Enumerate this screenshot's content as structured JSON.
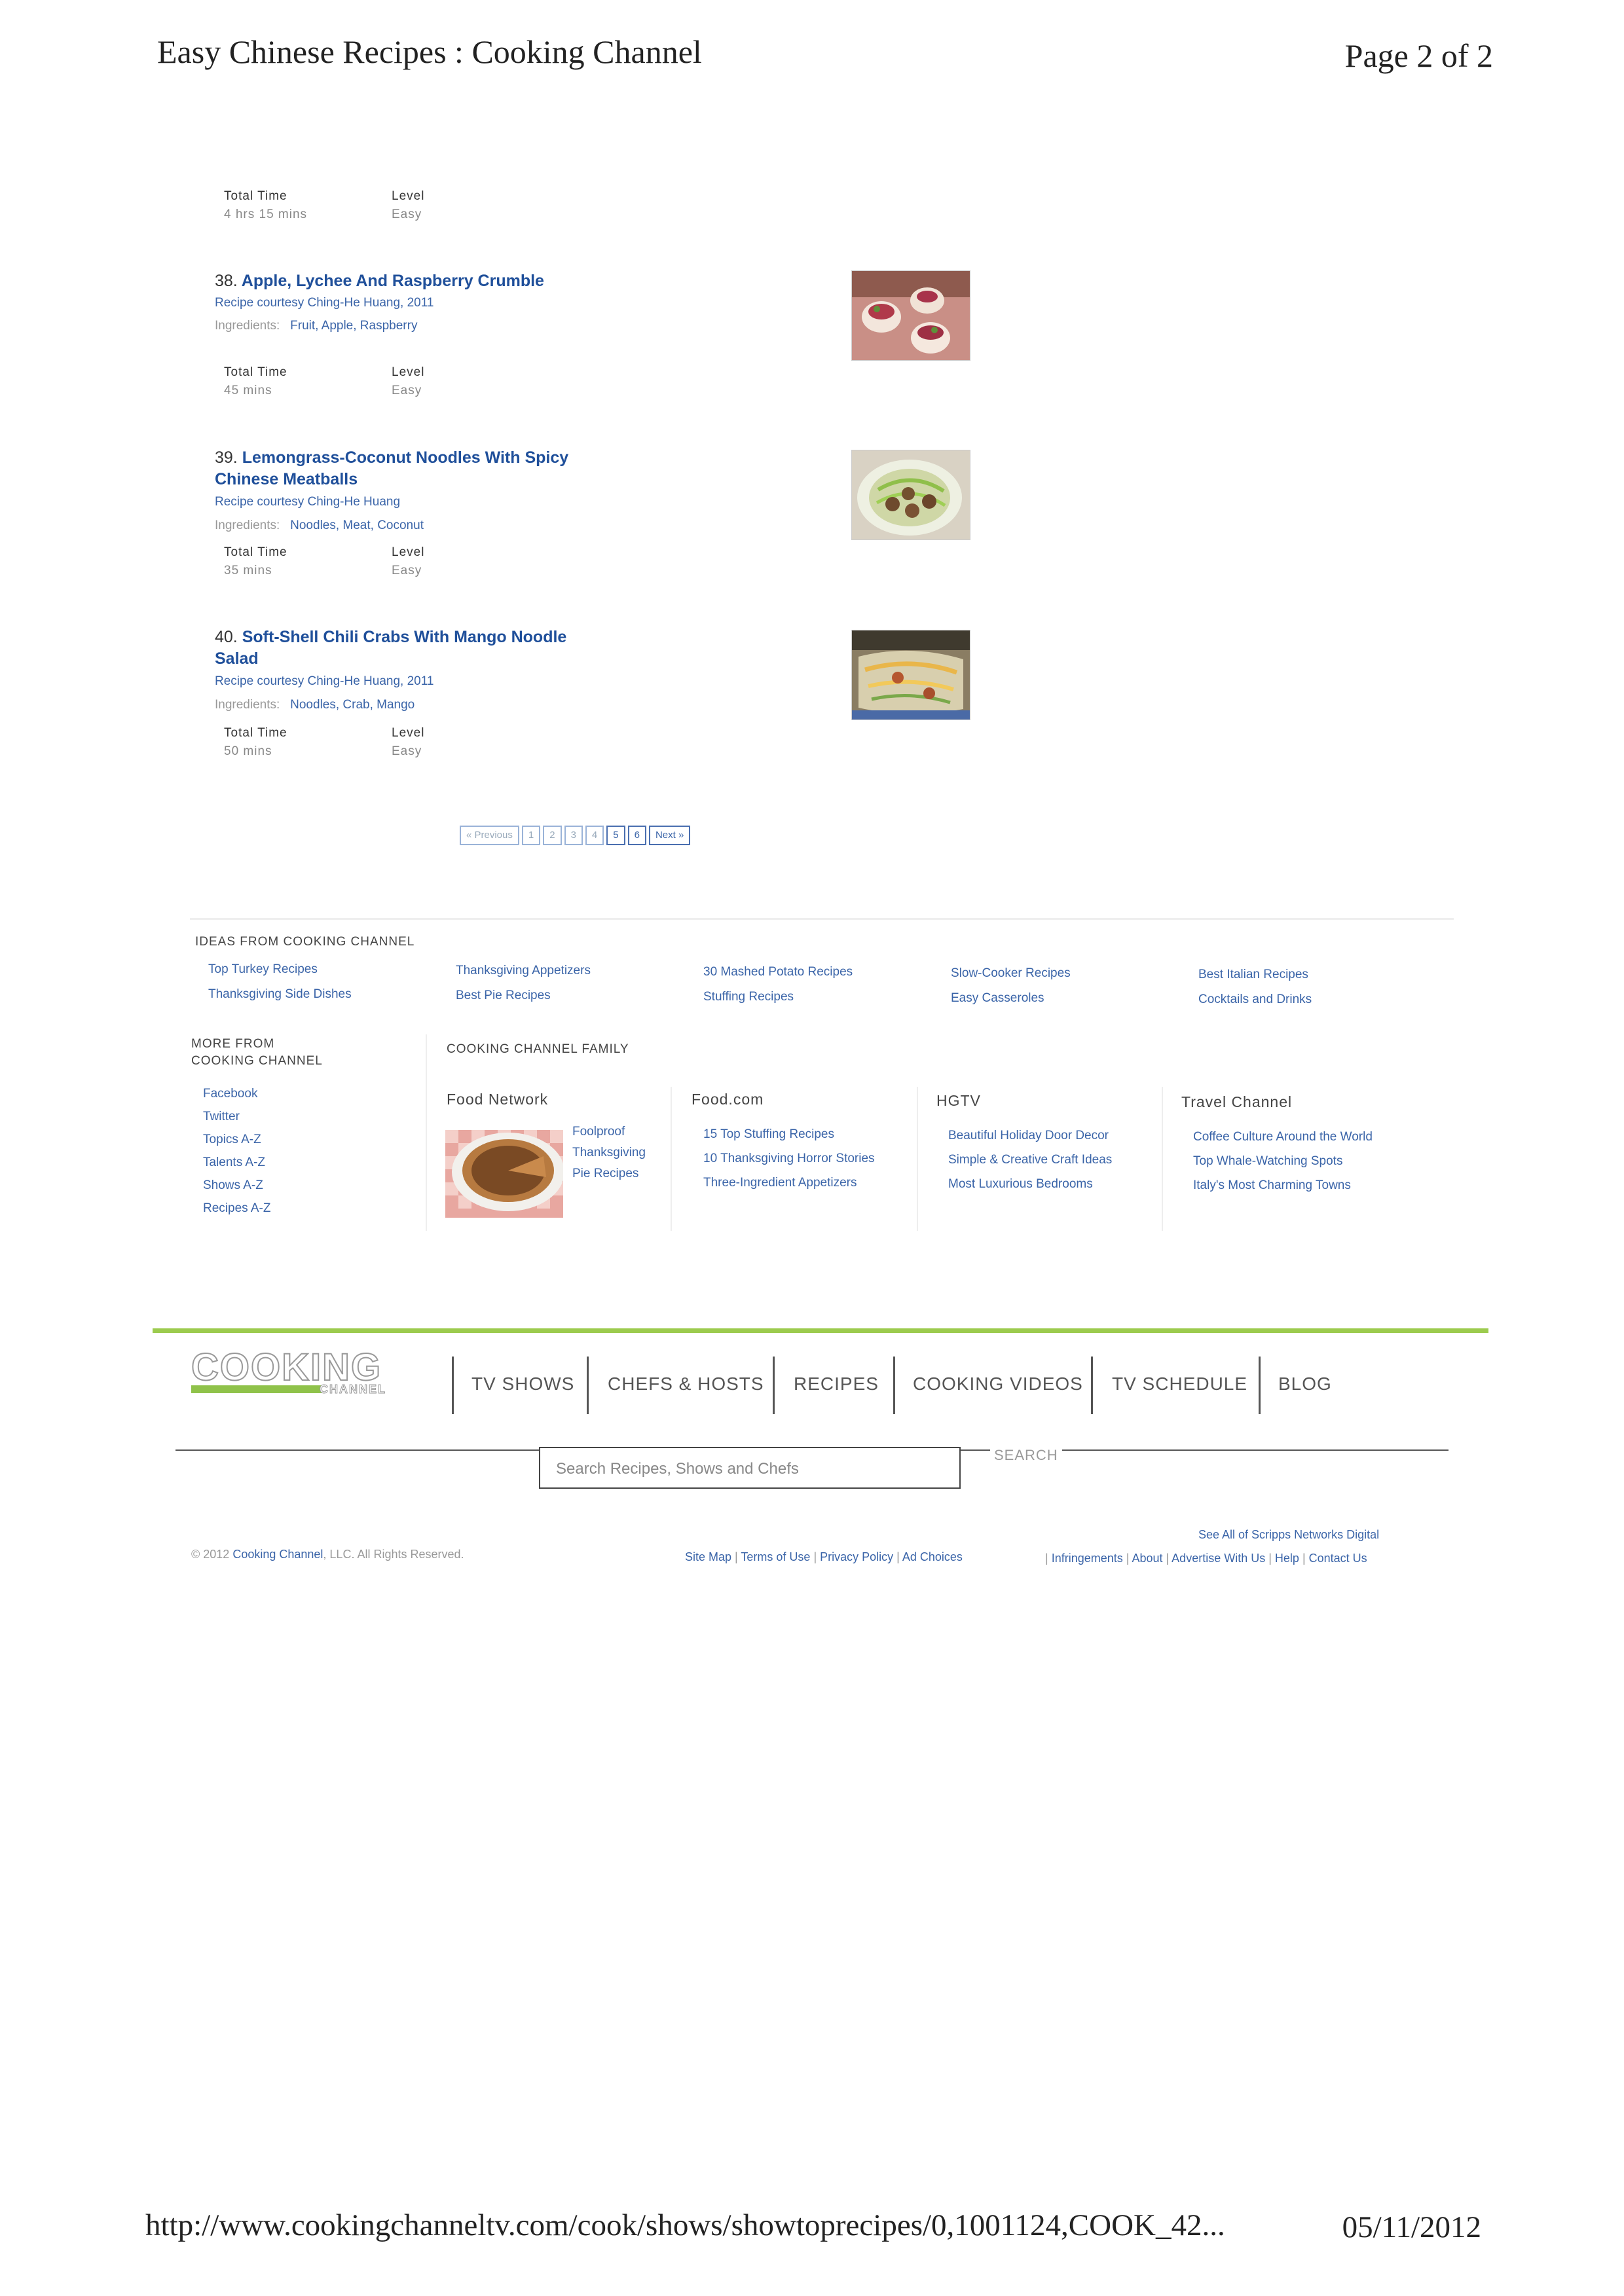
{
  "print_header": {
    "title": "Easy Chinese Recipes : Cooking Channel",
    "page": "Page 2 of 2"
  },
  "print_footer": {
    "url": "http://www.cookingchanneltv.com/cook/shows/showtoprecipes/0,1001124,COOK_42...",
    "date": "05/11/2012"
  },
  "labels": {
    "total_time": "Total Time",
    "level": "Level",
    "ingredients": "Ingredients:"
  },
  "recipe_37": {
    "time": "4 hrs 15 mins",
    "level": "Easy"
  },
  "recipes": [
    {
      "num": "38.",
      "title": "Apple, Lychee And Raspberry Crumble",
      "courtesy": "Recipe courtesy Ching-He Huang, 2011",
      "ingredients": "Fruit, Apple, Raspberry",
      "time": "45 mins",
      "level": "Easy",
      "image": "crumble-photo"
    },
    {
      "num": "39.",
      "title": "Lemongrass-Coconut Noodles With Spicy Chinese Meatballs",
      "courtesy": "Recipe courtesy Ching-He Huang",
      "ingredients": "Noodles, Meat, Coconut",
      "time": "35 mins",
      "level": "Easy",
      "image": "noodles-meatballs-photo"
    },
    {
      "num": "40.",
      "title": "Soft-Shell Chili Crabs With Mango Noodle Salad",
      "courtesy": "Recipe courtesy Ching-He Huang, 2011",
      "ingredients": "Noodles, Crab, Mango",
      "time": "50 mins",
      "level": "Easy",
      "image": "crab-salad-photo"
    }
  ],
  "pagination": {
    "prev": "« Previous",
    "pages": [
      "1",
      "2",
      "3",
      "4",
      "5",
      "6"
    ],
    "next": "Next »"
  },
  "ideas": {
    "heading": "IDEAS FROM COOKING CHANNEL",
    "columns": [
      [
        "Top Turkey Recipes",
        "Thanksgiving Side Dishes"
      ],
      [
        "Thanksgiving Appetizers",
        "Best Pie Recipes"
      ],
      [
        "30 Mashed Potato Recipes",
        "Stuffing Recipes"
      ],
      [
        "Slow-Cooker Recipes",
        "Easy Casseroles"
      ],
      [
        "Best Italian Recipes",
        "Cocktails and Drinks"
      ]
    ]
  },
  "more_from": {
    "heading_1": "MORE FROM",
    "heading_2": "COOKING CHANNEL",
    "links": [
      "Facebook",
      "Twitter",
      "Topics A-Z",
      "Talents A-Z",
      "Shows A-Z",
      "Recipes A-Z"
    ]
  },
  "family": {
    "heading": "COOKING CHANNEL FAMILY",
    "food_network": {
      "name": "Food Network",
      "feature_1": "Foolproof",
      "feature_2": "Thanksgiving",
      "feature_3": "Pie Recipes"
    },
    "food_com": {
      "name": "Food.com",
      "links": [
        "15 Top Stuffing Recipes",
        "10 Thanksgiving Horror Stories",
        "Three-Ingredient Appetizers"
      ]
    },
    "hgtv": {
      "name": "HGTV",
      "links": [
        "Beautiful Holiday Door Decor",
        "Simple & Creative Craft Ideas",
        "Most Luxurious Bedrooms"
      ]
    },
    "travel": {
      "name": "Travel Channel",
      "links": [
        "Coffee Culture Around the World",
        "Top Whale-Watching Spots",
        "Italy's Most Charming Towns"
      ]
    }
  },
  "site_nav": {
    "logo_main": "COOKING",
    "logo_sub": "CHANNEL",
    "items": [
      "TV SHOWS",
      "CHEFS & HOSTS",
      "RECIPES",
      "COOKING VIDEOS",
      "TV SCHEDULE",
      "BLOG"
    ]
  },
  "search": {
    "placeholder": "Search Recipes, Shows and Chefs",
    "button": "SEARCH"
  },
  "legal": {
    "copyright_prefix": "© 2012",
    "copyright_brand": "Cooking Channel",
    "copyright_suffix": ", LLC. All Rights Reserved.",
    "scripps": "See All of Scripps Networks Digital",
    "links_left": [
      "Site Map",
      "Terms of Use",
      "Privacy Policy",
      "Ad Choices"
    ],
    "links_right": [
      "Infringements",
      "About",
      "Advertise With Us",
      "Help",
      "Contact Us"
    ]
  },
  "colors": {
    "link": "#3a64a8",
    "title_link": "#1f4f9a",
    "accent_green": "#9ccb4e"
  }
}
